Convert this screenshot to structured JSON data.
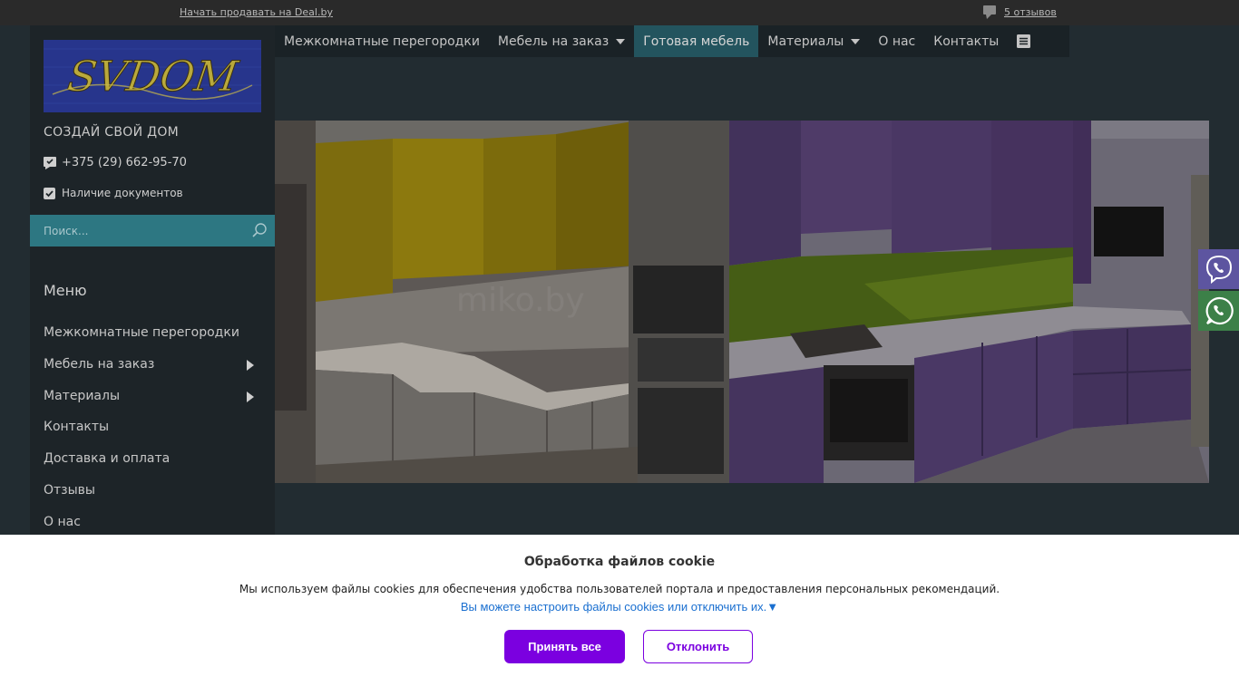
{
  "topbar": {
    "sell_link": "Начать продавать на Deal.by",
    "reviews_link": "5 отзывов"
  },
  "sidebar": {
    "logo_text": "SVDOM",
    "tagline": "СОЗДАЙ СВОЙ ДОМ",
    "phone": "+375 (29) 662-95-70",
    "docs": "Наличие документов",
    "search_placeholder": "Поиск...",
    "menu_title": "Меню",
    "menu_items": [
      {
        "label": "Межкомнатные перегородки",
        "has_submenu": false
      },
      {
        "label": "Мебель на заказ",
        "has_submenu": true
      },
      {
        "label": "Материалы",
        "has_submenu": true
      },
      {
        "label": "Контакты",
        "has_submenu": false
      },
      {
        "label": "Доставка и оплата",
        "has_submenu": false
      },
      {
        "label": "Отзывы",
        "has_submenu": false
      },
      {
        "label": "О нас",
        "has_submenu": false
      }
    ]
  },
  "nav": {
    "items": [
      {
        "label": "Межкомнатные перегородки",
        "dropdown": false,
        "active": false
      },
      {
        "label": "Мебель на заказ",
        "dropdown": true,
        "active": false
      },
      {
        "label": "Готовая мебель",
        "dropdown": false,
        "active": true
      },
      {
        "label": "Материалы",
        "dropdown": true,
        "active": false
      },
      {
        "label": "О нас",
        "dropdown": false,
        "active": false
      },
      {
        "label": "Контакты",
        "dropdown": false,
        "active": false
      }
    ],
    "more_icon": "list-icon"
  },
  "banner": {
    "watermark": "miko.by",
    "left_cabinet_color": "#a08a10",
    "right_cabinet_color": "#5a4477"
  },
  "messengers": [
    {
      "name": "viber-icon",
      "color": "#5d55a0"
    },
    {
      "name": "whatsapp-icon",
      "color": "#3c8048"
    }
  ],
  "cookie": {
    "title": "Обработка файлов cookie",
    "description": "Мы используем файлы cookies для обеспечения удобства пользователей портала и предоставления персональных рекомендаций.",
    "settings_link": "Вы можете настроить файлы cookies или отключить их.▼",
    "accept_label": "Принять все",
    "decline_label": "Отклонить"
  },
  "colors": {
    "accent": "#7b00e0",
    "active_nav": "#23545e",
    "search_bar": "#2d7782"
  }
}
